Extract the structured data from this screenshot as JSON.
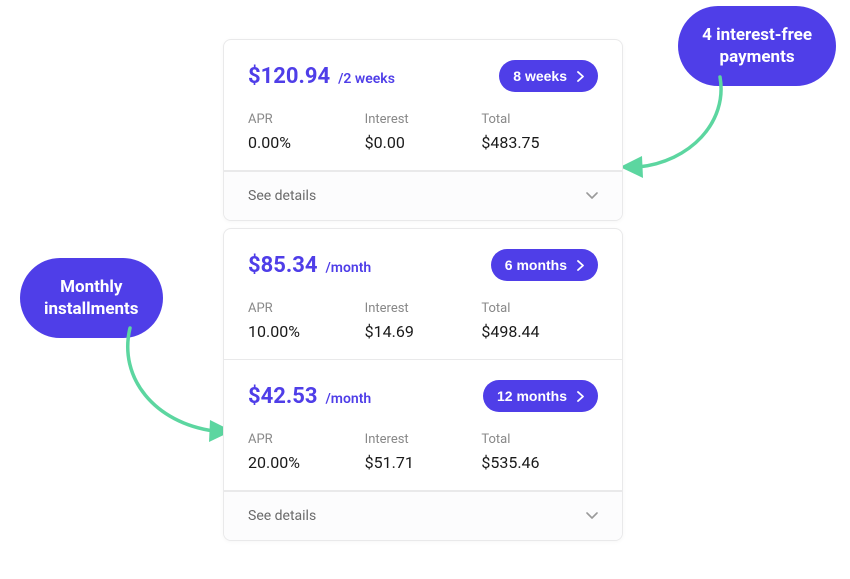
{
  "callouts": {
    "interest_free": "4 interest-free\npayments",
    "monthly": "Monthly\ninstallments"
  },
  "labels": {
    "apr": "APR",
    "interest": "Interest",
    "total": "Total",
    "see_details": "See details"
  },
  "card_interest_free": {
    "plan": {
      "amount": "$120.94",
      "period": "/2 weeks",
      "badge": "8 weeks",
      "apr": "0.00%",
      "interest": "$0.00",
      "total": "$483.75"
    }
  },
  "card_monthly": {
    "plans": [
      {
        "amount": "$85.34",
        "period": "/month",
        "badge": "6 months",
        "apr": "10.00%",
        "interest": "$14.69",
        "total": "$498.44"
      },
      {
        "amount": "$42.53",
        "period": "/month",
        "badge": "12 months",
        "apr": "20.00%",
        "interest": "$51.71",
        "total": "$535.46"
      }
    ]
  }
}
